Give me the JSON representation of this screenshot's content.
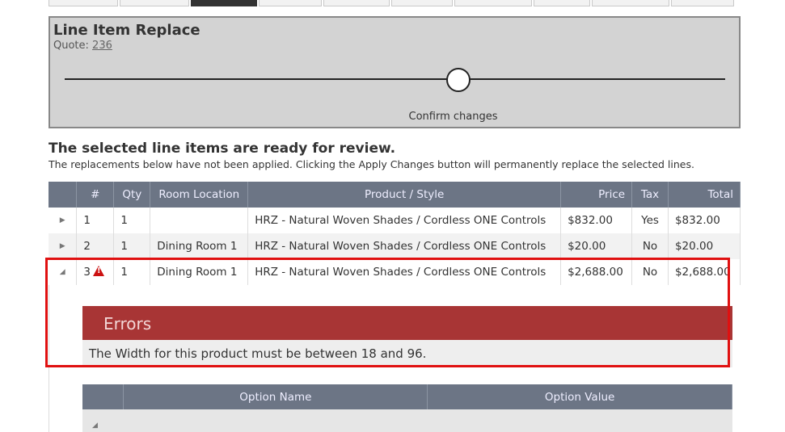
{
  "wizard": {
    "title": "Line Item Replace",
    "quote_label": "Quote:",
    "quote_number": "236",
    "step_label": "Confirm changes"
  },
  "review": {
    "title": "The selected line items are ready for review.",
    "subtitle": "The replacements below have not been applied. Clicking the Apply Changes button will permanently replace the selected lines."
  },
  "grid": {
    "headers": [
      "",
      "#",
      "Qty",
      "Room Location",
      "Product / Style",
      "Price",
      "Tax",
      "Total"
    ],
    "rows": [
      {
        "num": "1",
        "qty": "1",
        "room": "",
        "product": "HRZ - Natural Woven Shades / Cordless ONE Controls",
        "price": "$832.00",
        "tax": "Yes",
        "total": "$832.00"
      },
      {
        "num": "2",
        "qty": "1",
        "room": "Dining Room 1",
        "product": "HRZ - Natural Woven Shades / Cordless ONE Controls",
        "price": "$20.00",
        "tax": "No",
        "total": "$20.00"
      },
      {
        "num": "3",
        "qty": "1",
        "room": "Dining Room 1",
        "product": "HRZ - Natural Woven Shades / Cordless ONE Controls",
        "price": "$2,688.00",
        "tax": "No",
        "total": "$2,688.00"
      }
    ]
  },
  "errors": {
    "title": "Errors",
    "message": "The Width for this product must be between 18 and 96."
  },
  "options": {
    "headers": [
      "",
      "Option Name",
      "Option Value"
    ]
  },
  "colors": {
    "header_bg": "#6c7585",
    "error_bg": "#a83535",
    "highlight": "#e01010"
  },
  "icons": {
    "collapsed": "triangle-right",
    "expanded": "triangle-down",
    "warning": "warning-triangle"
  }
}
